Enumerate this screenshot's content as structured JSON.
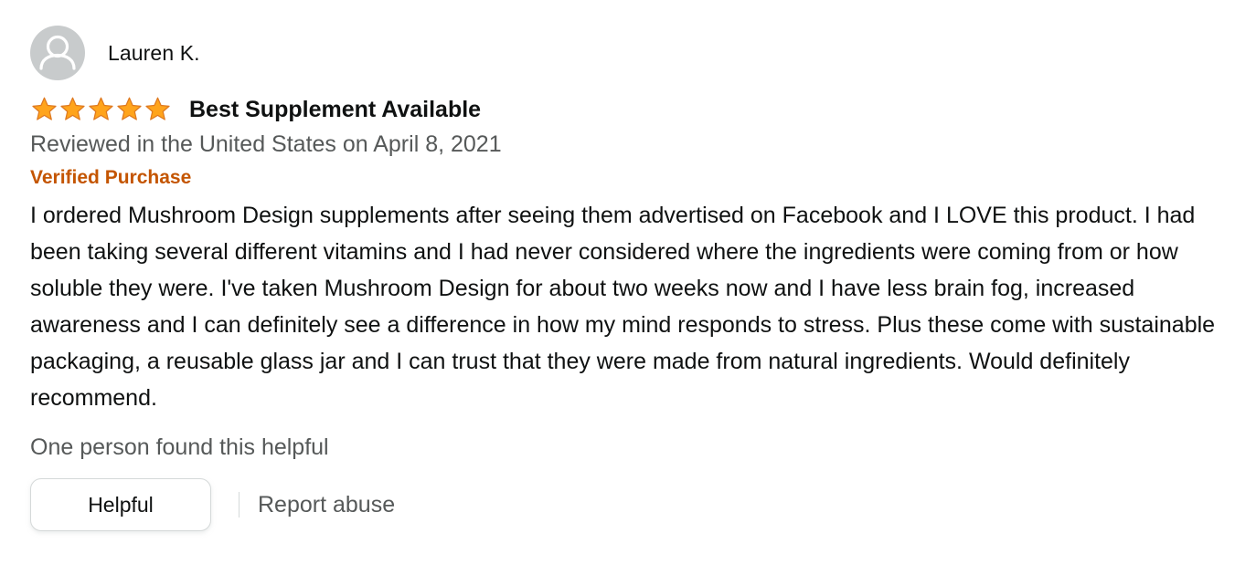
{
  "reviewer": {
    "name": "Lauren K.",
    "avatar_icon": "default-profile-icon"
  },
  "rating": {
    "value": 5,
    "max": 5,
    "star_color": "#ffa41c"
  },
  "review": {
    "title": "Best Supplement Available",
    "date": "Reviewed in the United States on April 8, 2021",
    "verified": "Verified Purchase",
    "body": "I ordered Mushroom Design supplements after seeing them advertised on Facebook and I LOVE this product. I had been taking several different vitamins and I had never considered where the ingredients were coming from or how soluble they were. I've taken Mushroom Design for about two weeks now and I have less brain fog, increased awareness and I can definitely see a difference in how my mind responds to stress. Plus these come with sustainable packaging, a reusable glass jar and I can trust that they were made from natural ingredients. Would definitely recommend."
  },
  "helpful_count_text": "One person found this helpful",
  "actions": {
    "helpful_label": "Helpful",
    "report_label": "Report abuse"
  },
  "colors": {
    "verified": "#c45500",
    "secondary_text": "#565959",
    "primary_text": "#0f1111"
  }
}
